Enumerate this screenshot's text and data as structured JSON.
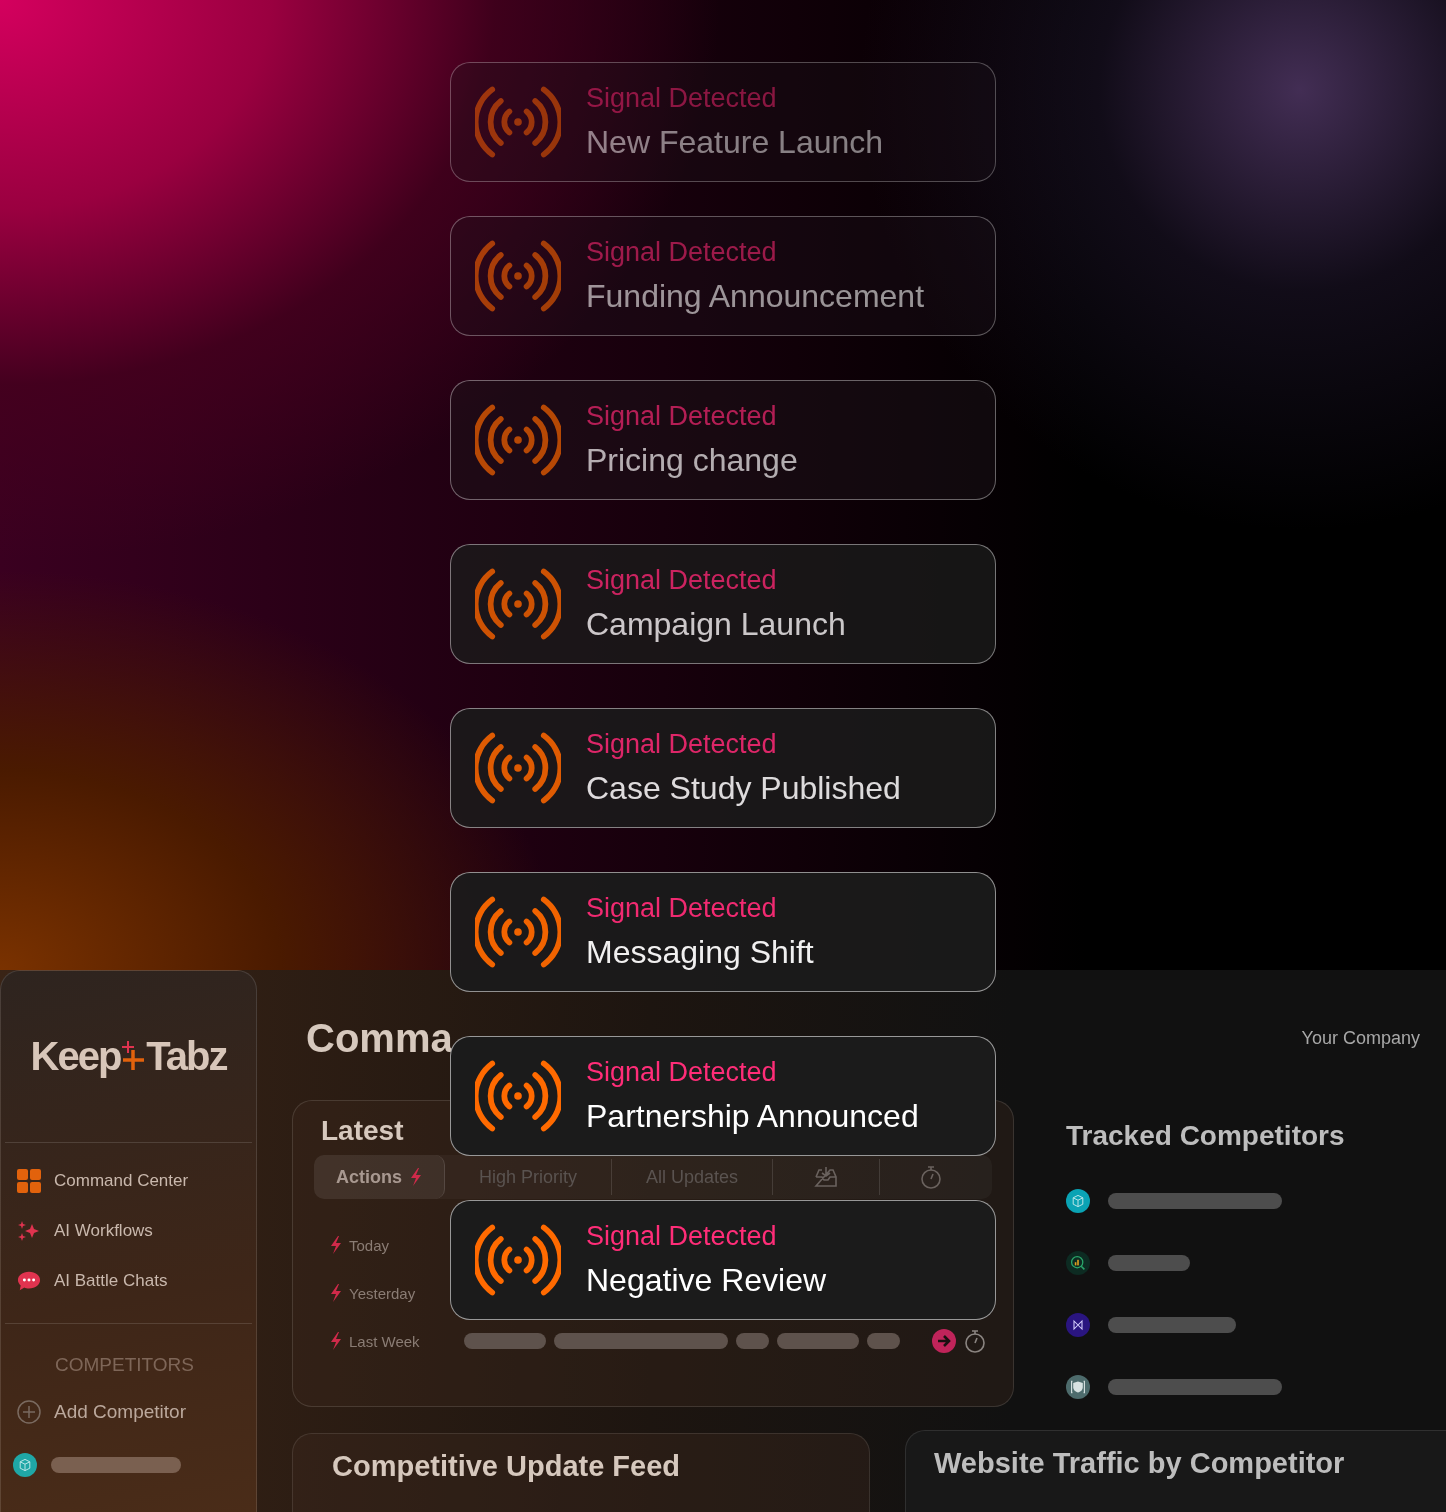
{
  "signals": [
    {
      "label": "Signal Detected",
      "title": "New Feature Launch"
    },
    {
      "label": "Signal Detected",
      "title": "Funding Announcement"
    },
    {
      "label": "Signal Detected",
      "title": "Pricing change"
    },
    {
      "label": "Signal Detected",
      "title": "Campaign Launch"
    },
    {
      "label": "Signal Detected",
      "title": "Case Study Published"
    },
    {
      "label": "Signal Detected",
      "title": "Messaging Shift"
    },
    {
      "label": "Signal Detected",
      "title": "Partnership Announced"
    },
    {
      "label": "Signal Detected",
      "title": "Negative Review"
    }
  ],
  "sidebar": {
    "logo": {
      "left": "Keep",
      "right": "Tabz"
    },
    "items": [
      {
        "kind": "grid",
        "label": "Command Center"
      },
      {
        "kind": "sparkle",
        "label": "AI Workflows"
      },
      {
        "kind": "chat",
        "label": "AI Battle Chats"
      }
    ],
    "section": "COMPETITORS",
    "add": "Add Competitor",
    "competitors": [
      {
        "kind": "cube",
        "color": "#1fa7a6"
      }
    ]
  },
  "header": {
    "title": "Comma",
    "company": "Your Company"
  },
  "latest": {
    "title": "Latest",
    "tabs": [
      {
        "kind": "text",
        "label": "Actions",
        "selected": true
      },
      {
        "kind": "text",
        "label": "High Priority",
        "selected": false
      },
      {
        "kind": "text",
        "label": "All Updates",
        "selected": false
      },
      {
        "kind": "inbox",
        "selected": false
      },
      {
        "kind": "timer",
        "selected": false
      }
    ],
    "rows": [
      {
        "label": "Today"
      },
      {
        "label": "Yesterday"
      },
      {
        "label": "Last Week",
        "preview": true
      }
    ]
  },
  "tracked": {
    "title": "Tracked Competitors",
    "items": [
      {
        "kind": "cube",
        "color": "#0aa3b4"
      },
      {
        "kind": "chart",
        "color": "#0d2b22"
      },
      {
        "kind": "bowtie",
        "color": "#2a1580"
      },
      {
        "kind": "shield",
        "color": "#4d6b6c"
      }
    ]
  },
  "feed": {
    "title": "Competitive Update Feed"
  },
  "traffic": {
    "title": "Website Traffic by Competitor"
  }
}
